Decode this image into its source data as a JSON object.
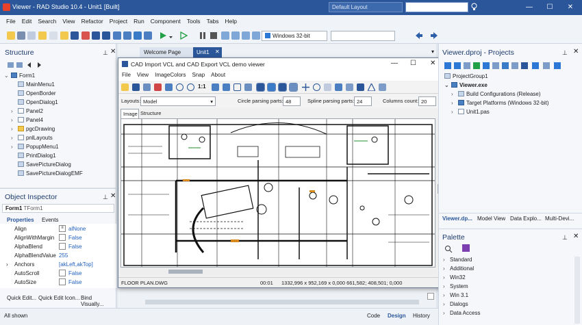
{
  "titlebar": {
    "title": "Viewer - RAD Studio 10.4 - Unit1 [Built]",
    "layout": "Default Layout",
    "minimize": "—",
    "maximize": "☐",
    "close": "✕"
  },
  "menu": [
    "File",
    "Edit",
    "Search",
    "View",
    "Refactor",
    "Project",
    "Run",
    "Component",
    "Tools",
    "Tabs",
    "Help"
  ],
  "toolbar": {
    "platform": "Windows 32-bit",
    "config": ""
  },
  "structure": {
    "title": "Structure",
    "root": "Form1",
    "items": [
      "MainMenu1",
      "OpenBorder",
      "OpenDialog1",
      "Panel2",
      "Panel4",
      "pgcDrawing",
      "pnlLayouts",
      "PopupMenu1",
      "PrintDialog1",
      "SavePictureDialog",
      "SavePictureDialogEMF"
    ]
  },
  "inspector": {
    "title": "Object Inspector",
    "object": "Form1",
    "type": "TForm1",
    "tabs": [
      "Properties",
      "Events"
    ],
    "rows": [
      {
        "name": "Align",
        "value": "alNone"
      },
      {
        "name": "AlignWithMargin",
        "value": "False"
      },
      {
        "name": "AlphaBlend",
        "value": "False"
      },
      {
        "name": "AlphaBlendValue",
        "value": "255"
      },
      {
        "name": "Anchors",
        "value": "[akLeft,akTop]"
      },
      {
        "name": "AutoScroll",
        "value": "False"
      },
      {
        "name": "AutoSize",
        "value": "False"
      }
    ],
    "footer": [
      "Quick Edit...",
      "Quick Edit Icon...",
      "Bind Visually..."
    ],
    "shown": "All shown"
  },
  "editor": {
    "tabs": [
      "Welcome Page",
      "Unit1"
    ],
    "bottom_tabs": [
      "Code",
      "Design",
      "History"
    ]
  },
  "viewer": {
    "title": "CAD Import VCL and CAD Export VCL demo viewer",
    "menu": [
      "File",
      "View",
      "ImageColors",
      "Snap",
      "About"
    ],
    "scale": "1:1",
    "layouts_label": "Layouts:",
    "layouts_value": "Model",
    "circle_label": "Circle parsing parts:",
    "circle_value": "48",
    "spline_label": "Spline parsing parts:",
    "spline_value": "24",
    "columns_label": "Columns count:",
    "columns_value": "20",
    "tabs": [
      "Image",
      "Structure"
    ],
    "status_file": "FLOOR PLAN.DWG",
    "status_time": "00:01",
    "status_coords": "1332,996 x 952,169 x 0,000 661,582; 408,501; 0,000"
  },
  "project": {
    "title": "Viewer.dproj - Projects",
    "group": "ProjectGroup1",
    "exe": "Viewer.exe",
    "items": [
      "Build Configurations (Release)",
      "Target Platforms (Windows 32-bit)",
      "Unit1.pas"
    ],
    "tabs": [
      "Viewer.dp...",
      "Model View",
      "Data Explo...",
      "Multi-Devi..."
    ]
  },
  "palette": {
    "title": "Palette",
    "items": [
      "Standard",
      "Additional",
      "Win32",
      "System",
      "Win 3.1",
      "Dialogs",
      "Data Access"
    ]
  },
  "colors": {
    "accent": "#2b579a",
    "tab_active": "#2b579a"
  }
}
